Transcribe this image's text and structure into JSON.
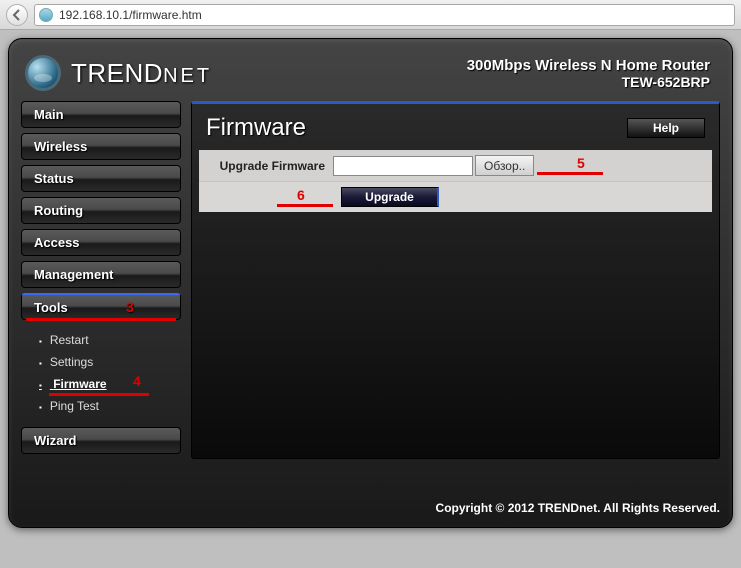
{
  "browser": {
    "url": "192.168.10.1/firmware.htm"
  },
  "brand": "TRENDNET",
  "product": {
    "line1": "300Mbps Wireless N Home Router",
    "line2": "TEW-652BRP"
  },
  "nav": {
    "main": "Main",
    "wireless": "Wireless",
    "status": "Status",
    "routing": "Routing",
    "access": "Access",
    "management": "Management",
    "tools": "Tools",
    "wizard": "Wizard"
  },
  "tools_submenu": {
    "restart": "Restart",
    "settings": "Settings",
    "firmware": "Firmware",
    "pingtest": "Ping Test"
  },
  "page": {
    "title": "Firmware",
    "help": "Help"
  },
  "form": {
    "upgrade_label": "Upgrade Firmware",
    "browse": "Обзор..",
    "upgrade_btn": "Upgrade"
  },
  "annotations": {
    "a3": "3",
    "a4": "4",
    "a5": "5",
    "a6": "6"
  },
  "footer": "Copyright © 2012 TRENDnet. All Rights Reserved."
}
